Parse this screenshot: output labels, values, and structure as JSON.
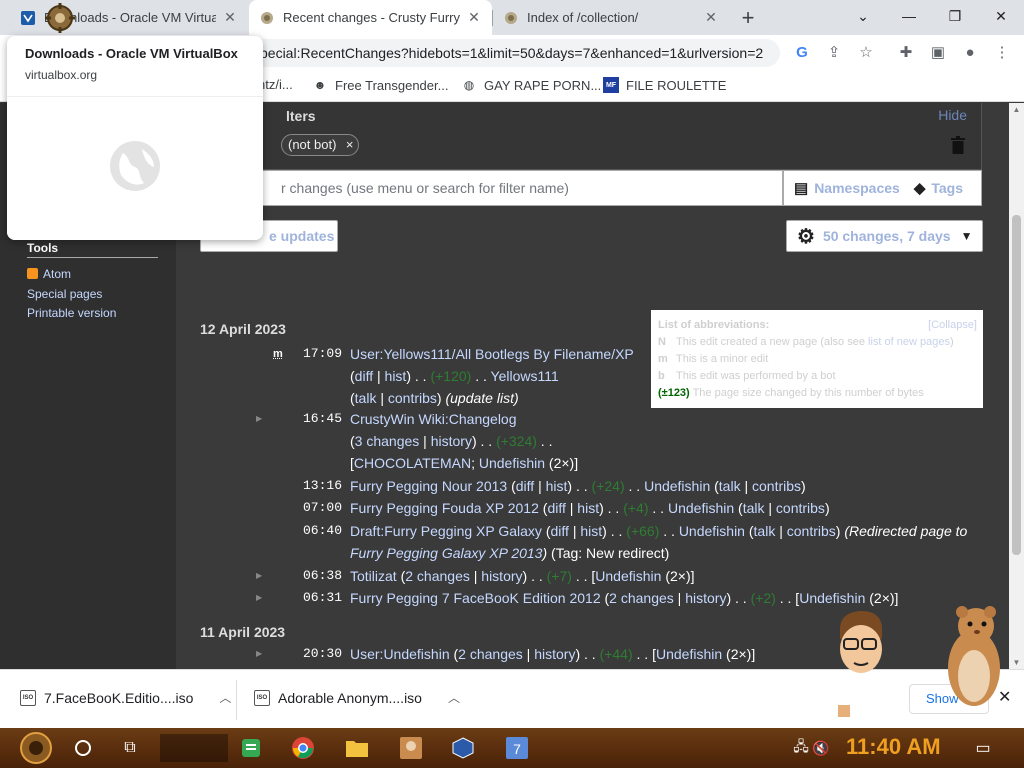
{
  "browser": {
    "tabs": [
      {
        "title": "Downloads - Oracle VM VirtualBox",
        "active": false
      },
      {
        "title": "Recent changes - Crusty Furry",
        "active": true
      },
      {
        "title": "Index of /collection/",
        "active": false
      }
    ],
    "url": "pecial:RecentChanges?hidebots=1&limit=50&days=7&enhanced=1&urlversion=2",
    "bookmarks": [
      {
        "label": "ntz/i...",
        "icon": "puzzle-icon"
      },
      {
        "label": "Free Transgender...",
        "icon": "mask-icon"
      },
      {
        "label": "GAY RAPE PORN...",
        "icon": "globe-icon"
      },
      {
        "label": "FILE ROULETTE",
        "icon": "mf-icon"
      }
    ]
  },
  "hovercard": {
    "title": "Downloads - Oracle VM VirtualBox",
    "url": "virtualbox.org"
  },
  "sidebar": {
    "tools_heading": "Tools",
    "links": [
      "Atom",
      "Special pages",
      "Printable version"
    ]
  },
  "filters": {
    "title": "lters",
    "hide": "Hide",
    "chip": "(not bot)",
    "chip_close": "×",
    "input_placeholder": "r changes (use menu or search for filter name)",
    "namespaces": "Namespaces",
    "tags": "Tags",
    "live_updates": "e updates",
    "limit_label": "50 changes, 7 days"
  },
  "legend": {
    "title": "List of abbreviations:",
    "collapse": "[Collapse]",
    "n_key": "N",
    "n_text_a": "This edit created a new page (also see ",
    "n_link": "list of new pages",
    "n_text_b": ")",
    "m_key": "m",
    "m_text": "This is a minor edit",
    "b_key": "b",
    "b_text": "This edit was performed by a bot",
    "delta_key": "(±123)",
    "delta_text": "The page size changed by this number of bytes"
  },
  "changes": {
    "date1": "12 April 2023",
    "date2": "11 April 2023",
    "r1": {
      "time": "17:09",
      "flag": "m",
      "title": "User:Yellows111/All Bootlegs By Filename/XP",
      "diff": "diff",
      "hist": "hist",
      "delta": "(+120)",
      "user": "Yellows111",
      "talk": "talk",
      "contribs": "contribs",
      "summary": "(update list)"
    },
    "r2": {
      "time": "16:45",
      "title": "CrustyWin Wiki:Changelog",
      "changes": "3 changes",
      "history": "history",
      "delta": "(+324)",
      "users_a": "CHOCOLATEMAN",
      "users_b": "Undefishin",
      "count": "(2×)"
    },
    "r3": {
      "time": "13:16",
      "title": "Furry Pegging Nour 2013",
      "diff": "diff",
      "hist": "hist",
      "delta": "(+24)",
      "user": "Undefishin",
      "talk": "talk",
      "contribs": "contribs"
    },
    "r4": {
      "time": "07:00",
      "title": "Furry Pegging Fouda XP 2012",
      "diff": "diff",
      "hist": "hist",
      "delta": "(+4)",
      "user": "Undefishin",
      "talk": "talk",
      "contribs": "contribs"
    },
    "r5": {
      "time": "06:40",
      "title": "Draft:Furry Pegging XP Galaxy",
      "diff": "diff",
      "hist": "hist",
      "delta": "(+66)",
      "user": "Undefishin",
      "talk": "talk",
      "contribs": "contribs",
      "summary_a": "(Redirected page to ",
      "summary_link": "Furry Pegging Galaxy XP 2013",
      "summary_b": ")",
      "tag": "(Tag: New redirect)"
    },
    "r6": {
      "time": "06:38",
      "title": "Totilizat",
      "changes": "2 changes",
      "history": "history",
      "delta": "(+7)",
      "user": "Undefishin",
      "count": "(2×)"
    },
    "r7": {
      "time": "06:31",
      "title": "Furry Pegging 7 FaceBooK Edition 2012",
      "changes": "2 changes",
      "history": "history",
      "delta": "(+2)",
      "user": "Undefishin",
      "count": "(2×)"
    },
    "r8": {
      "time": "20:30",
      "title": "User:Undefishin",
      "changes": "2 changes",
      "history": "history",
      "delta": "(+44)",
      "user": "Undefishin",
      "count": "(2×)"
    }
  },
  "downloads": {
    "items": [
      "7.FaceBooK.Editio....iso",
      "Adorable Anonym....iso"
    ],
    "file_badge": "ISO",
    "show_all": "Show"
  },
  "taskbar": {
    "time": "11:40 AM"
  },
  "colors": {
    "link": "#c5d8ff",
    "positive_delta": "#2e7d32",
    "page_bg": "#3a3a3a",
    "sidebar_bg": "#2f2f2f"
  }
}
